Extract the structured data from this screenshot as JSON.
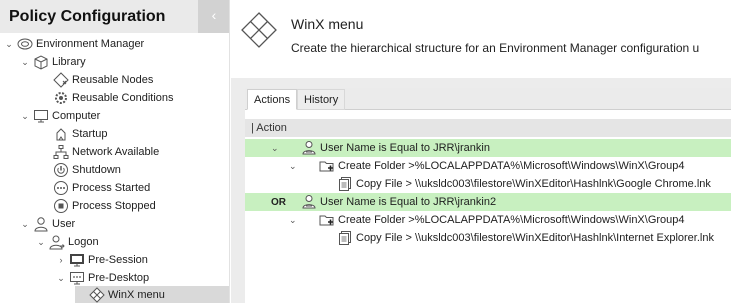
{
  "sidebar": {
    "title": "Policy Configuration",
    "collapse_glyph": "‹",
    "tree": [
      {
        "label": "Environment Manager",
        "icon": "environment-manager-icon"
      },
      {
        "label": "Library",
        "icon": "library-icon"
      },
      {
        "label": "Reusable Nodes",
        "icon": "reusable-nodes-icon"
      },
      {
        "label": "Reusable Conditions",
        "icon": "reusable-conditions-icon"
      },
      {
        "label": "Computer",
        "icon": "computer-icon"
      },
      {
        "label": "Startup",
        "icon": "startup-icon"
      },
      {
        "label": "Network Available",
        "icon": "network-icon"
      },
      {
        "label": "Shutdown",
        "icon": "shutdown-icon"
      },
      {
        "label": "Process Started",
        "icon": "process-started-icon"
      },
      {
        "label": "Process Stopped",
        "icon": "process-stopped-icon"
      },
      {
        "label": "User",
        "icon": "user-icon"
      },
      {
        "label": "Logon",
        "icon": "logon-icon"
      },
      {
        "label": "Pre-Session",
        "icon": "pre-session-icon"
      },
      {
        "label": "Pre-Desktop",
        "icon": "pre-desktop-icon"
      },
      {
        "label": "WinX menu",
        "icon": "winx-menu-icon",
        "selected": true
      }
    ]
  },
  "header": {
    "title": "WinX menu",
    "description": "Create the hierarchical structure for an Environment Manager configuration u",
    "icon": "winx-menu-icon"
  },
  "tabs": [
    "Actions",
    "History"
  ],
  "active_tab": "Actions",
  "grid": {
    "column_header": "| Action",
    "rows": [
      {
        "text": "User Name is Equal to JRR\\jrankin",
        "icon": "user-condition-icon",
        "type": "condition"
      },
      {
        "text": "Create Folder >%LOCALAPPDATA%\\Microsoft\\Windows\\WinX\\Group4",
        "icon": "create-folder-icon",
        "type": "action"
      },
      {
        "text": "Copy File > \\\\uksldc003\\filestore\\WinXEditor\\Hashlnk\\Google Chrome.lnk",
        "icon": "copy-file-icon",
        "type": "action"
      },
      {
        "prefix": "OR",
        "text": "User Name is Equal to JRR\\jrankin2",
        "icon": "user-condition-icon",
        "type": "condition"
      },
      {
        "text": "Create Folder >%LOCALAPPDATA%\\Microsoft\\Windows\\WinX\\Group4",
        "icon": "create-folder-icon",
        "type": "action"
      },
      {
        "text": "Copy File > \\\\uksldc003\\filestore\\WinXEditor\\Hashlnk\\Internet Explorer.lnk",
        "icon": "copy-file-icon",
        "type": "action"
      }
    ]
  },
  "colors": {
    "condition_row": "#c8f0c0",
    "selected_node": "#d9d9d9",
    "main_background": "#ececec"
  }
}
